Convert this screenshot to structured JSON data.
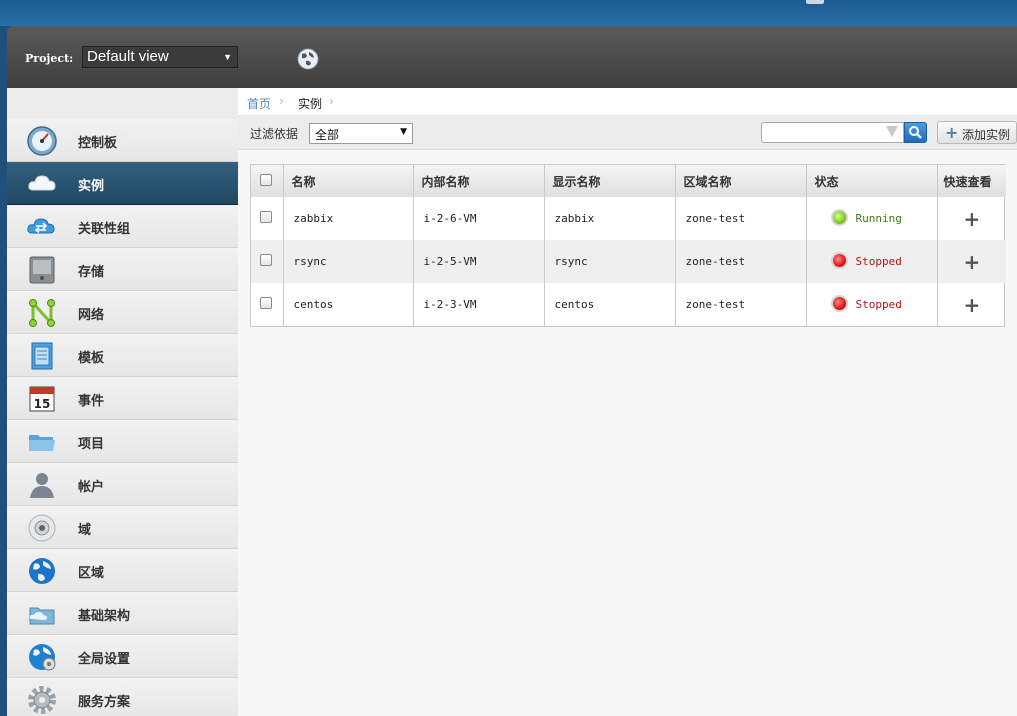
{
  "header": {
    "project_label": "Project:",
    "project_value": "Default view"
  },
  "sidebar": {
    "items": [
      {
        "label": "控制板",
        "icon": "dashboard-icon"
      },
      {
        "label": "实例",
        "icon": "cloud-icon",
        "active": true
      },
      {
        "label": "关联性组",
        "icon": "affinity-group-icon"
      },
      {
        "label": "存储",
        "icon": "storage-icon"
      },
      {
        "label": "网络",
        "icon": "network-icon"
      },
      {
        "label": "模板",
        "icon": "template-icon"
      },
      {
        "label": "事件",
        "icon": "calendar-icon"
      },
      {
        "label": "项目",
        "icon": "folder-icon"
      },
      {
        "label": "帐户",
        "icon": "user-icon"
      },
      {
        "label": "域",
        "icon": "domain-icon"
      },
      {
        "label": "区域",
        "icon": "globe-icon"
      },
      {
        "label": "基础架构",
        "icon": "infrastructure-icon"
      },
      {
        "label": "全局设置",
        "icon": "global-settings-icon"
      },
      {
        "label": "服务方案",
        "icon": "gear-icon"
      }
    ]
  },
  "breadcrumb": {
    "home": "首页",
    "current": "实例",
    "sep": "›"
  },
  "filter": {
    "label": "过滤依据",
    "value": "全部",
    "search_placeholder": "",
    "add_label": "添加实例"
  },
  "table": {
    "headers": [
      "名称",
      "内部名称",
      "显示名称",
      "区域名称",
      "状态",
      "快速查看"
    ],
    "rows": [
      {
        "name": "zabbix",
        "internal": "i-2-6-VM",
        "display": "zabbix",
        "zone": "zone-test",
        "state": "Running",
        "quickview": "+"
      },
      {
        "name": "rsync",
        "internal": "i-2-5-VM",
        "display": "rsync",
        "zone": "zone-test",
        "state": "Stopped",
        "quickview": "+"
      },
      {
        "name": "centos",
        "internal": "i-2-3-VM",
        "display": "centos",
        "zone": "zone-test",
        "state": "Stopped",
        "quickview": "+"
      }
    ]
  },
  "colors": {
    "sidebar_active": "#2b5571",
    "running": "#78c81e",
    "stopped": "#e01010",
    "link": "#5a8bb3"
  }
}
